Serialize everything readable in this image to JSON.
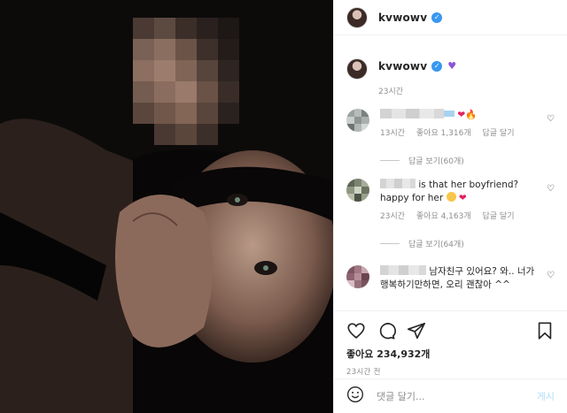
{
  "header": {
    "username": "kvwowv",
    "verified": true
  },
  "caption": {
    "username": "kvwowv",
    "emoji": "purple-heart",
    "time": "23시간"
  },
  "comments": [
    {
      "text": "",
      "emoji_text": "❤🔥",
      "time": "13시간",
      "likes": "좋아요 1,316개",
      "reply": "답글 달기",
      "view_replies": "답글 보기(60개)"
    },
    {
      "text": "is that her boyfriend? happy for her",
      "emoji_text": "❤",
      "time": "23시간",
      "likes": "좋아요 4,163개",
      "reply": "답글 달기",
      "view_replies": "답글 보기(64개)"
    },
    {
      "text_visible": "남자친구 있어요? 와.. 너가 행복하기만하면, 오리 괜찮아 ^^"
    }
  ],
  "post": {
    "likes": "좋아요 234,932개",
    "time": "23시간 전"
  },
  "comment_input": {
    "placeholder": "댓글 달기...",
    "submit_label": "게시"
  },
  "colors": {
    "verified": "#3897f0",
    "link": "#b2dffc",
    "muted": "#8e8e8e"
  },
  "icons": [
    "heart-icon",
    "comment-icon",
    "share-icon",
    "bookmark-icon",
    "smile-icon",
    "verified-badge-icon"
  ]
}
